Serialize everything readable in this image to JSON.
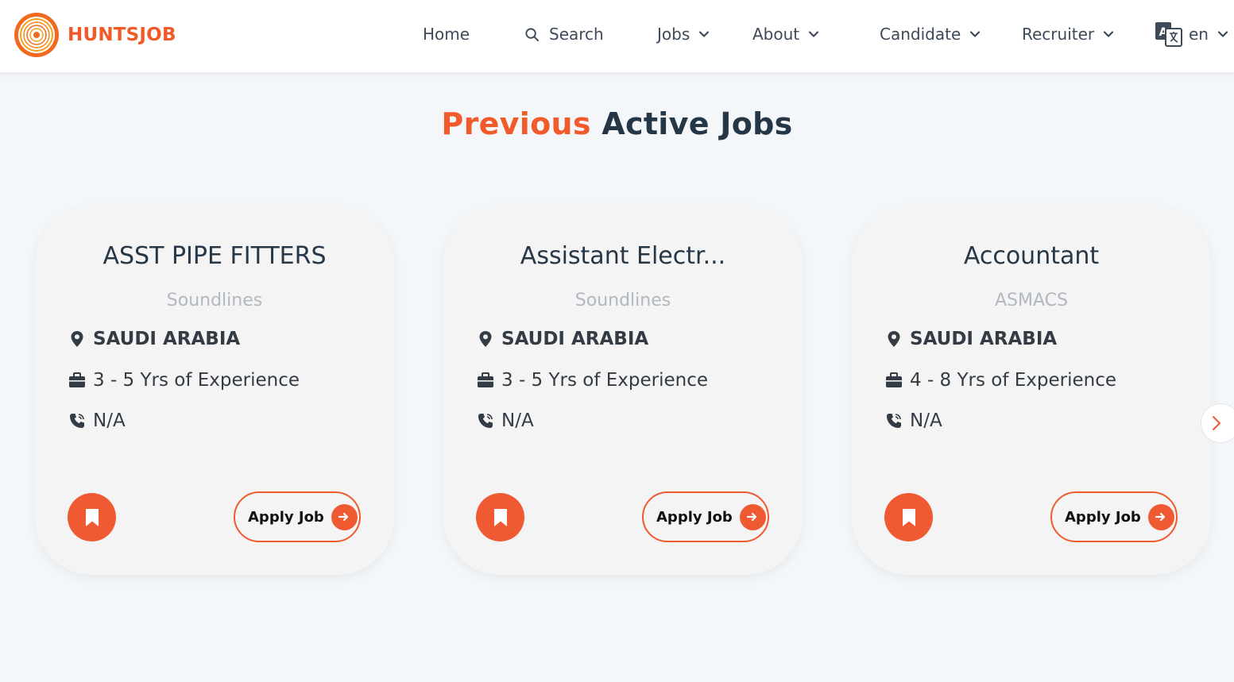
{
  "brand": {
    "name": "HUNTSJOB",
    "color": "#f05a28"
  },
  "nav": {
    "home": "Home",
    "search": "Search",
    "jobs": "Jobs",
    "about": "About",
    "candidate": "Candidate",
    "recruiter": "Recruiter",
    "language": "en"
  },
  "section": {
    "title_accent": "Previous",
    "title_main": "Active Jobs"
  },
  "cards": [
    {
      "title": "ASST PIPE FITTERS",
      "company": "Soundlines",
      "location": "SAUDI ARABIA",
      "experience": "3 - 5 Yrs of Experience",
      "phone": "N/A",
      "apply_label": "Apply Job"
    },
    {
      "title": "Assistant Electr...",
      "company": "Soundlines",
      "location": "SAUDI ARABIA",
      "experience": "3 - 5 Yrs of Experience",
      "phone": "N/A",
      "apply_label": "Apply Job"
    },
    {
      "title": "Accountant",
      "company": "ASMACS",
      "location": "SAUDI ARABIA",
      "experience": "4 - 8 Yrs of Experience",
      "phone": "N/A",
      "apply_label": "Apply Job"
    }
  ],
  "colors": {
    "accent": "#f05a32",
    "heading": "#253646",
    "background": "#f4f7fa",
    "card": "#f4f4f4"
  },
  "icons": [
    "logo-icon",
    "search-icon",
    "chevron-down-icon",
    "translate-icon",
    "location-pin-icon",
    "briefcase-icon",
    "phone-icon",
    "bookmark-icon",
    "arrow-right-icon",
    "chevron-right-icon"
  ]
}
